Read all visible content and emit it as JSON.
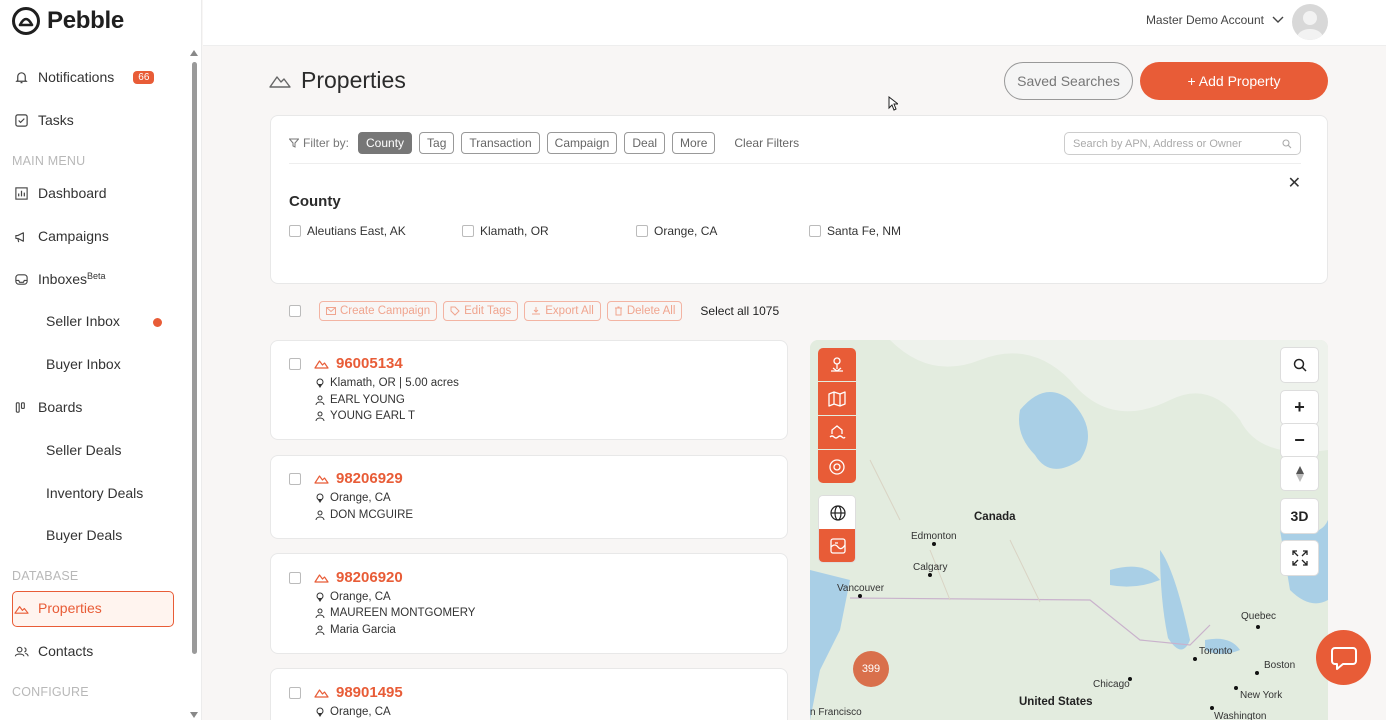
{
  "app": {
    "name": "Pebble"
  },
  "header": {
    "account_name": "Master Demo Account"
  },
  "sidebar": {
    "top_items": [
      {
        "label": "Notifications",
        "badge": "66"
      },
      {
        "label": "Tasks"
      }
    ],
    "sections": {
      "main_menu": "MAIN MENU",
      "database": "DATABASE",
      "configure": "CONFIGURE"
    },
    "main_menu": [
      {
        "label": "Dashboard"
      },
      {
        "label": "Campaigns"
      },
      {
        "label": "Inboxes",
        "sup": "Beta"
      },
      {
        "label": "Seller Inbox"
      },
      {
        "label": "Buyer Inbox"
      },
      {
        "label": "Boards"
      },
      {
        "label": "Seller Deals"
      },
      {
        "label": "Inventory Deals"
      },
      {
        "label": "Buyer Deals"
      }
    ],
    "database": [
      {
        "label": "Properties"
      },
      {
        "label": "Contacts"
      }
    ]
  },
  "page": {
    "title": "Properties",
    "saved_searches": "Saved Searches",
    "add_property": "+ Add Property"
  },
  "filters": {
    "filter_by": "Filter by:",
    "chips": [
      "County",
      "Tag",
      "Transaction",
      "Campaign",
      "Deal",
      "More"
    ],
    "clear": "Clear Filters",
    "search_placeholder": "Search by APN, Address or Owner",
    "section_title": "County",
    "counties": [
      "Aleutians East, AK",
      "Klamath, OR",
      "Orange, CA",
      "Santa Fe, NM"
    ]
  },
  "bulk": {
    "create_campaign": "Create Campaign",
    "edit_tags": "Edit Tags",
    "export_all": "Export All",
    "delete_all": "Delete All",
    "select_all": "Select all 1075"
  },
  "properties": [
    {
      "id": "96005134",
      "location": "Klamath, OR | 5.00 acres",
      "owners": [
        "EARL YOUNG",
        "YOUNG EARL T"
      ]
    },
    {
      "id": "98206929",
      "location": "Orange, CA",
      "owners": [
        "DON MCGUIRE"
      ]
    },
    {
      "id": "98206920",
      "location": "Orange, CA",
      "owners": [
        "MAUREEN MONTGOMERY",
        "Maria Garcia"
      ]
    },
    {
      "id": "98901495",
      "location": "Orange, CA",
      "owners": []
    }
  ],
  "map": {
    "controls": {
      "three_d": "3D",
      "zoom_in": "+",
      "zoom_out": "−"
    },
    "labels": {
      "canada": "Canada",
      "edmonton": "Edmonton",
      "calgary": "Calgary",
      "vancouver": "Vancouver",
      "quebec": "Quebec",
      "toronto": "Toronto",
      "chicago": "Chicago",
      "boston": "Boston",
      "united_states": "United States",
      "new_york": "New York",
      "san_francisco": "n Francisco",
      "washington": "Washington"
    },
    "cluster_count": "399"
  },
  "colors": {
    "accent": "#e85c37"
  }
}
